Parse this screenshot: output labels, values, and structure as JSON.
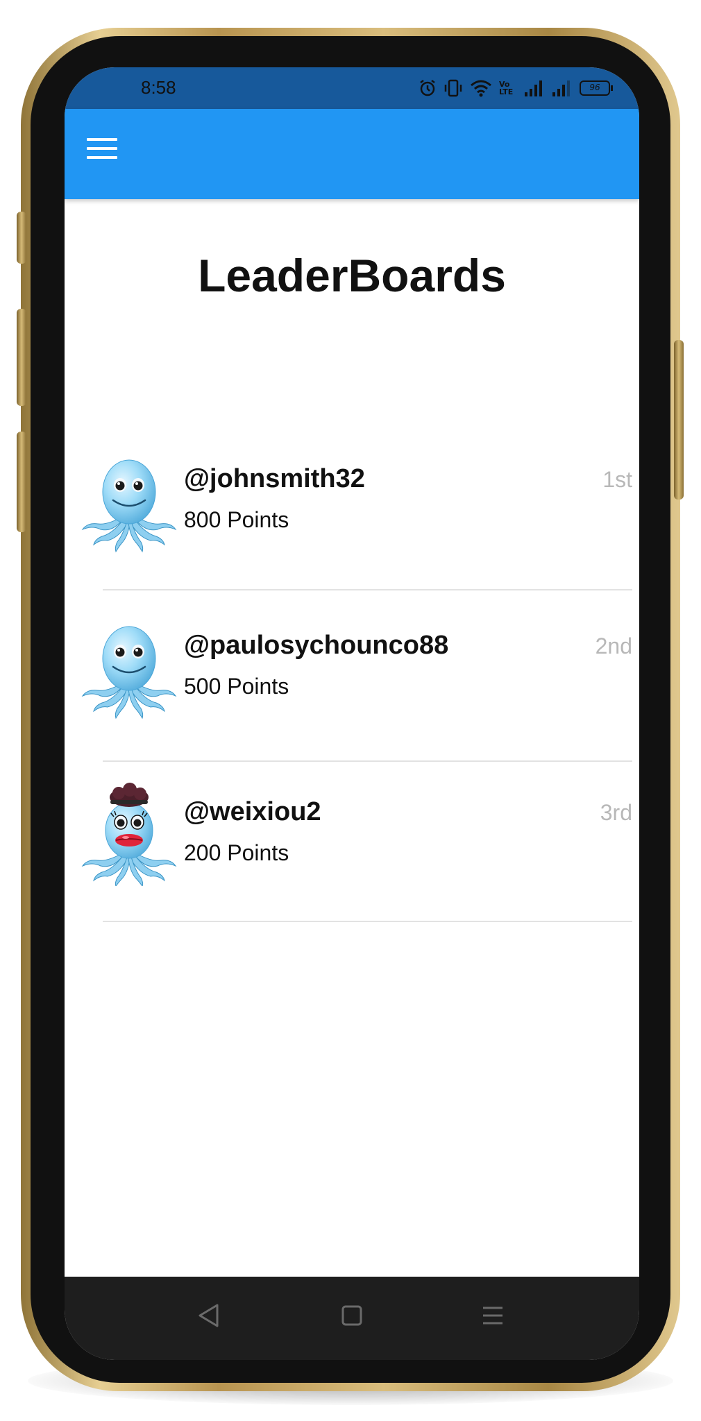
{
  "status_bar": {
    "time": "8:58",
    "battery": "96",
    "volte": "Vo LTE"
  },
  "app_bar": {
    "color": "#2196f3",
    "menu_icon": "hamburger-menu-icon"
  },
  "page": {
    "title": "LeaderBoards"
  },
  "leaderboard": [
    {
      "username": "@johnsmith32",
      "points": "800 Points",
      "rank": "1st",
      "avatar": "octopus-avatar-icon"
    },
    {
      "username": "@paulosychounco88",
      "points": "500 Points",
      "rank": "2nd",
      "avatar": "octopus-avatar-icon"
    },
    {
      "username": "@weixiou2",
      "points": "200 Points",
      "rank": "3rd",
      "avatar": "octopus-avatar-lips-icon"
    }
  ],
  "nav_bar": {
    "back_icon": "back-triangle-icon",
    "home_icon": "home-square-icon",
    "recents_icon": "recents-menu-icon"
  }
}
